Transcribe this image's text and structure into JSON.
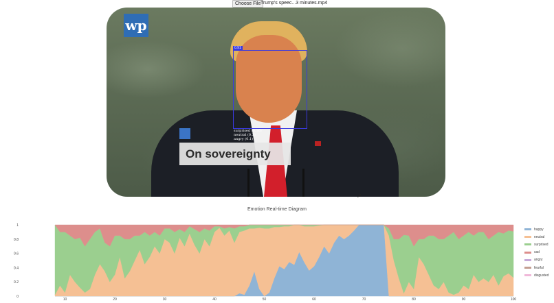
{
  "file_input": {
    "button_label": "Choose File",
    "file_name": "Trump's speec...3 minutes.mp4"
  },
  "video": {
    "logo_text": "wp",
    "confidence_label": "0.91",
    "emotion_lines": [
      "surprised (0.56)",
      "neutral (0.3)",
      "angry (0.1)"
    ],
    "caption": "On sovereignty"
  },
  "chart_data": {
    "type": "area",
    "title": "Emotion Real-time Diagram",
    "xlim": [
      0,
      100
    ],
    "ylim": [
      0,
      1
    ],
    "x_ticks": [
      "10",
      "20",
      "30",
      "40",
      "50",
      "60",
      "70",
      "80",
      "90",
      "100"
    ],
    "y_ticks": [
      "0",
      "0.2",
      "0.4",
      "0.6",
      "0.8",
      "1"
    ],
    "legend_position": "right",
    "colors": {
      "happy": "#8fb4d6",
      "neutral": "#f5c094",
      "surprised": "#9bcf8f",
      "sad": "#dd8e8c",
      "angry": "#c6a9d9",
      "fearful": "#c39e92",
      "disgusted": "#f0b8d9"
    },
    "x": [
      8,
      9,
      10,
      11,
      12,
      13,
      14,
      15,
      16,
      17,
      18,
      19,
      20,
      21,
      22,
      23,
      24,
      25,
      26,
      27,
      28,
      29,
      30,
      31,
      32,
      33,
      34,
      35,
      36,
      37,
      38,
      39,
      40,
      41,
      42,
      43,
      44,
      45,
      46,
      47,
      48,
      49,
      50,
      51,
      52,
      53,
      54,
      55,
      56,
      57,
      58,
      59,
      60,
      61,
      62,
      63,
      64,
      65,
      66,
      67,
      68,
      69,
      70,
      71,
      72,
      73,
      74,
      75,
      76,
      77,
      78,
      79,
      80,
      81,
      82,
      83,
      84,
      85,
      86,
      87,
      88,
      89,
      90,
      91,
      92,
      93,
      94,
      95,
      96,
      97,
      98,
      99,
      100
    ],
    "series": [
      {
        "name": "happy",
        "values": [
          0,
          0,
          0,
          0,
          0,
          0,
          0,
          0,
          0,
          0,
          0,
          0,
          0,
          0,
          0,
          0,
          0,
          0,
          0,
          0,
          0,
          0,
          0,
          0,
          0,
          0,
          0,
          0,
          0,
          0,
          0,
          0,
          0,
          0,
          0,
          0,
          0,
          0.04,
          0.02,
          0.15,
          0.35,
          0.1,
          0,
          0.05,
          0.25,
          0.42,
          0.38,
          0.48,
          0.44,
          0.62,
          0.48,
          0.36,
          0.42,
          0.55,
          0.7,
          0.6,
          0.75,
          0.85,
          0.8,
          0.85,
          0.92,
          1,
          1,
          1,
          1,
          1,
          1,
          0,
          0,
          0,
          0,
          0,
          0,
          0,
          0,
          0,
          0,
          0,
          0,
          0,
          0,
          0,
          0,
          0,
          0,
          0,
          0,
          0,
          0,
          0,
          0,
          0,
          0
        ]
      },
      {
        "name": "neutral",
        "values": [
          0.02,
          0.15,
          0.05,
          0.3,
          0.2,
          0.12,
          0.05,
          0.1,
          0.3,
          0.45,
          0.35,
          0.2,
          0.3,
          0.55,
          0.25,
          0.35,
          0.5,
          0.65,
          0.45,
          0.55,
          0.7,
          0.6,
          0.8,
          0.75,
          0.6,
          0.82,
          0.7,
          0.88,
          0.72,
          0.6,
          0.8,
          0.7,
          0.9,
          0.96,
          0.85,
          0.92,
          0.75,
          0.86,
          0.9,
          0.8,
          0.6,
          0.86,
          0.95,
          0.9,
          0.72,
          0.55,
          0.6,
          0.5,
          0.56,
          0.38,
          0.5,
          0.62,
          0.56,
          0.44,
          0.3,
          0.4,
          0.25,
          0.15,
          0.2,
          0.15,
          0.08,
          0,
          0,
          0,
          0,
          0,
          0,
          0.85,
          0.5,
          0.25,
          0.04,
          0.2,
          0.1,
          0.55,
          0.45,
          0.3,
          0.15,
          0.1,
          0.2,
          0.05,
          0.02,
          0.05,
          0.15,
          0.1,
          0.3,
          0.2,
          0.25,
          0.2,
          0.3,
          0.15,
          0.28,
          0.32,
          0.26
        ]
      },
      {
        "name": "surprised",
        "values": [
          0.98,
          0.75,
          0.85,
          0.55,
          0.6,
          0.7,
          0.65,
          0.7,
          0.6,
          0.5,
          0.4,
          0.5,
          0.55,
          0.3,
          0.55,
          0.45,
          0.35,
          0.2,
          0.45,
          0.3,
          0.2,
          0.25,
          0.15,
          0.2,
          0.3,
          0.12,
          0.2,
          0.1,
          0.22,
          0.3,
          0.15,
          0.22,
          0.08,
          0.02,
          0.1,
          0.05,
          0.2,
          0.08,
          0.06,
          0.05,
          0.05,
          0.04,
          0.05,
          0.05,
          0.03,
          0.03,
          0.02,
          0.02,
          0,
          0,
          0.02,
          0.02,
          0.02,
          0.01,
          0,
          0,
          0,
          0,
          0,
          0,
          0,
          0,
          0,
          0,
          0,
          0,
          0,
          0.1,
          0.3,
          0.55,
          0.82,
          0.65,
          0.6,
          0.25,
          0.35,
          0.55,
          0.7,
          0.7,
          0.6,
          0.8,
          0.88,
          0.75,
          0.7,
          0.8,
          0.55,
          0.7,
          0.65,
          0.6,
          0.55,
          0.75,
          0.6,
          0.6,
          0.65
        ]
      },
      {
        "name": "sad",
        "values": [
          0,
          0.1,
          0.1,
          0.15,
          0.2,
          0.18,
          0.3,
          0.2,
          0.1,
          0.05,
          0.25,
          0.3,
          0.15,
          0.15,
          0.2,
          0.2,
          0.15,
          0.15,
          0.1,
          0.15,
          0.1,
          0.15,
          0.05,
          0.05,
          0.1,
          0.06,
          0.1,
          0.02,
          0.06,
          0.1,
          0.05,
          0.08,
          0.02,
          0.02,
          0.05,
          0.03,
          0.05,
          0.02,
          0.02,
          0,
          0,
          0,
          0,
          0,
          0,
          0,
          0,
          0,
          0,
          0,
          0,
          0,
          0,
          0,
          0,
          0,
          0,
          0,
          0,
          0,
          0,
          0,
          0,
          0,
          0,
          0,
          0,
          0.05,
          0.2,
          0.2,
          0.14,
          0.15,
          0.3,
          0.2,
          0.2,
          0.15,
          0.15,
          0.2,
          0.2,
          0.15,
          0.1,
          0.2,
          0.15,
          0.1,
          0.15,
          0.1,
          0.1,
          0.2,
          0.15,
          0.1,
          0.12,
          0.08,
          0.09
        ]
      }
    ],
    "legend": [
      "happy",
      "neutral",
      "surprised",
      "sad",
      "angry",
      "fearful",
      "disgusted"
    ]
  }
}
